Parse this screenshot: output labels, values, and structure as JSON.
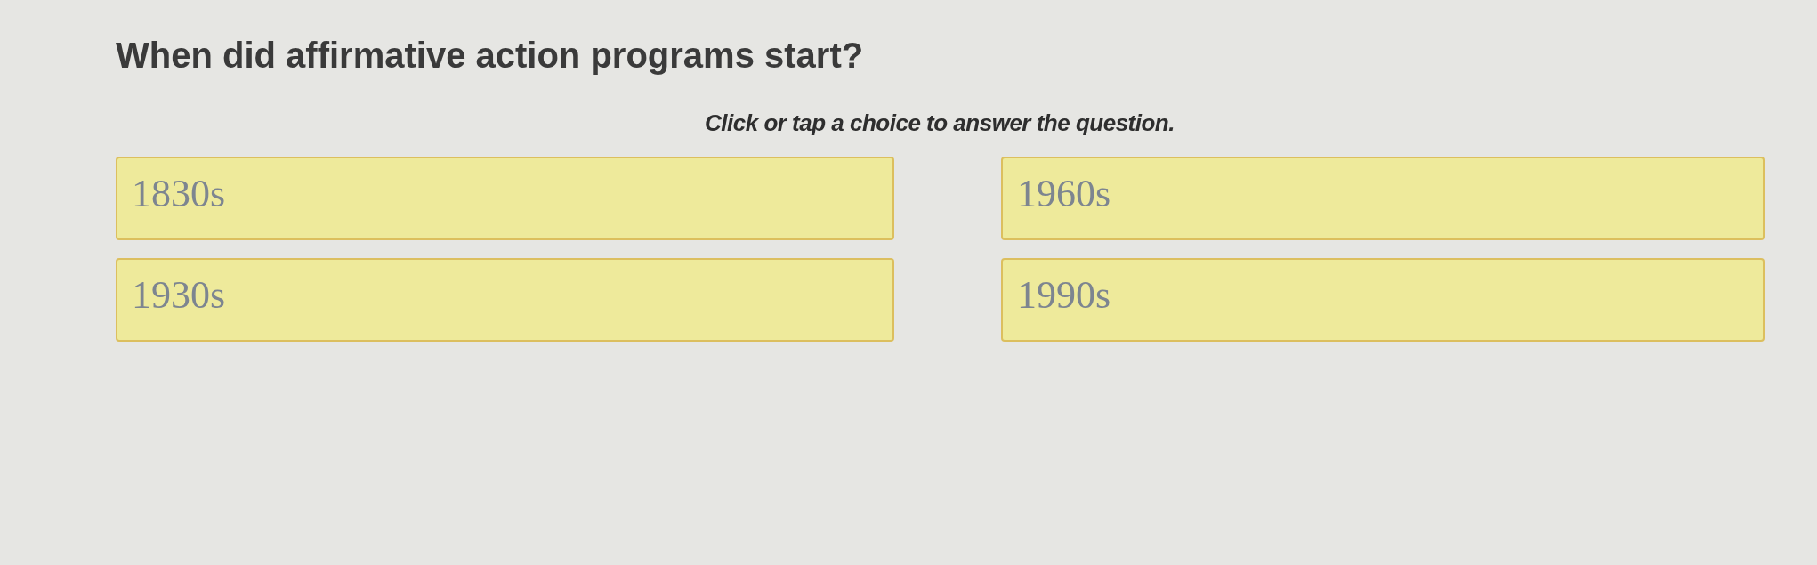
{
  "question": {
    "text": "When did affirmative action programs start?"
  },
  "instruction": "Click or tap a choice to answer the question.",
  "choices": [
    {
      "label": "1830s",
      "selected": false
    },
    {
      "label": "1960s",
      "selected": false
    },
    {
      "label": "1930s",
      "selected": false
    },
    {
      "label": "1990s",
      "selected": false
    }
  ]
}
